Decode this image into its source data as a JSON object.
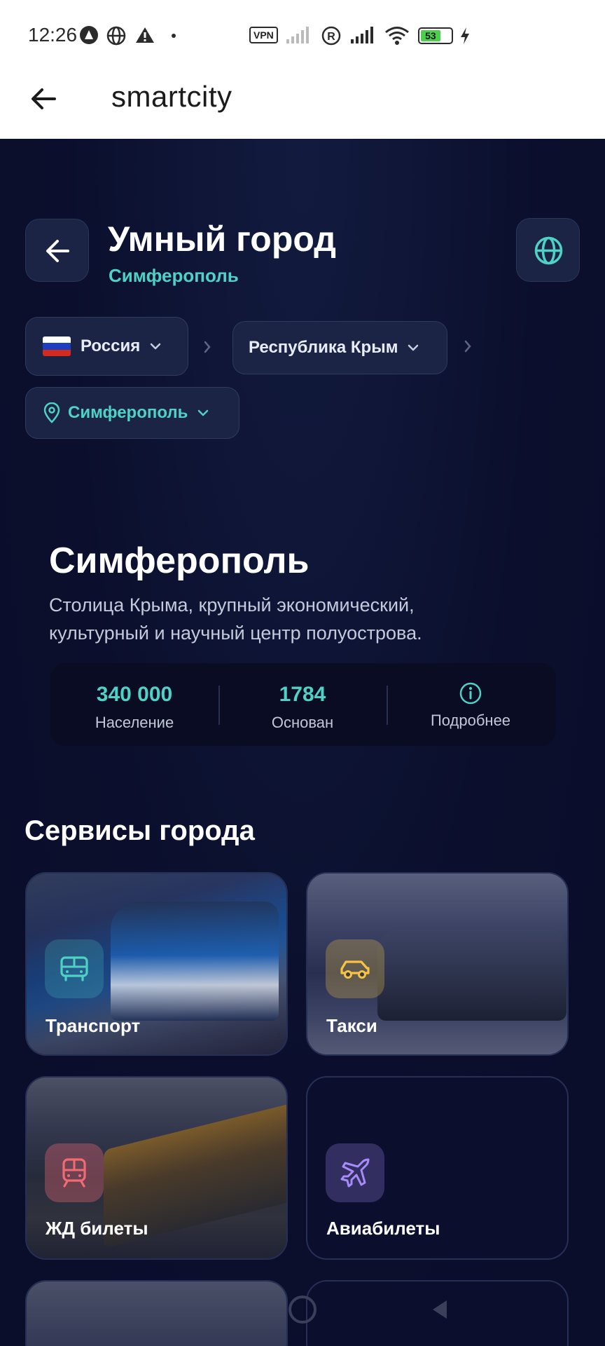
{
  "status_bar": {
    "time": "12:26",
    "battery": "53",
    "vpn": "VPN"
  },
  "app_bar": {
    "title": "smartcity"
  },
  "header": {
    "title": "Умный город",
    "subtitle": "Симферополь"
  },
  "location": {
    "country": "Россия",
    "region": "Республика Крым",
    "city": "Симферополь"
  },
  "city_info": {
    "name": "Симферополь",
    "description": "Столица Крыма, крупный экономический, культурный и научный центр полуострова.",
    "stats": [
      {
        "value": "340 000",
        "label": "Население"
      },
      {
        "value": "1784",
        "label": "Основан"
      }
    ],
    "more_label": "Подробнее"
  },
  "services": {
    "title": "Сервисы города",
    "items": [
      {
        "label": "Транспорт",
        "icon": "bus-icon",
        "color": "#4fd1c5"
      },
      {
        "label": "Такси",
        "icon": "car-icon",
        "color": "#f6c445"
      },
      {
        "label": "ЖД билеты",
        "icon": "train-icon",
        "color": "#f06b75"
      },
      {
        "label": "Авиабилеты",
        "icon": "plane-icon",
        "color": "#a78bfa"
      }
    ]
  },
  "colors": {
    "accent": "#4fd1c5",
    "background": "#0b0f2d",
    "surface": "#1b2444"
  }
}
